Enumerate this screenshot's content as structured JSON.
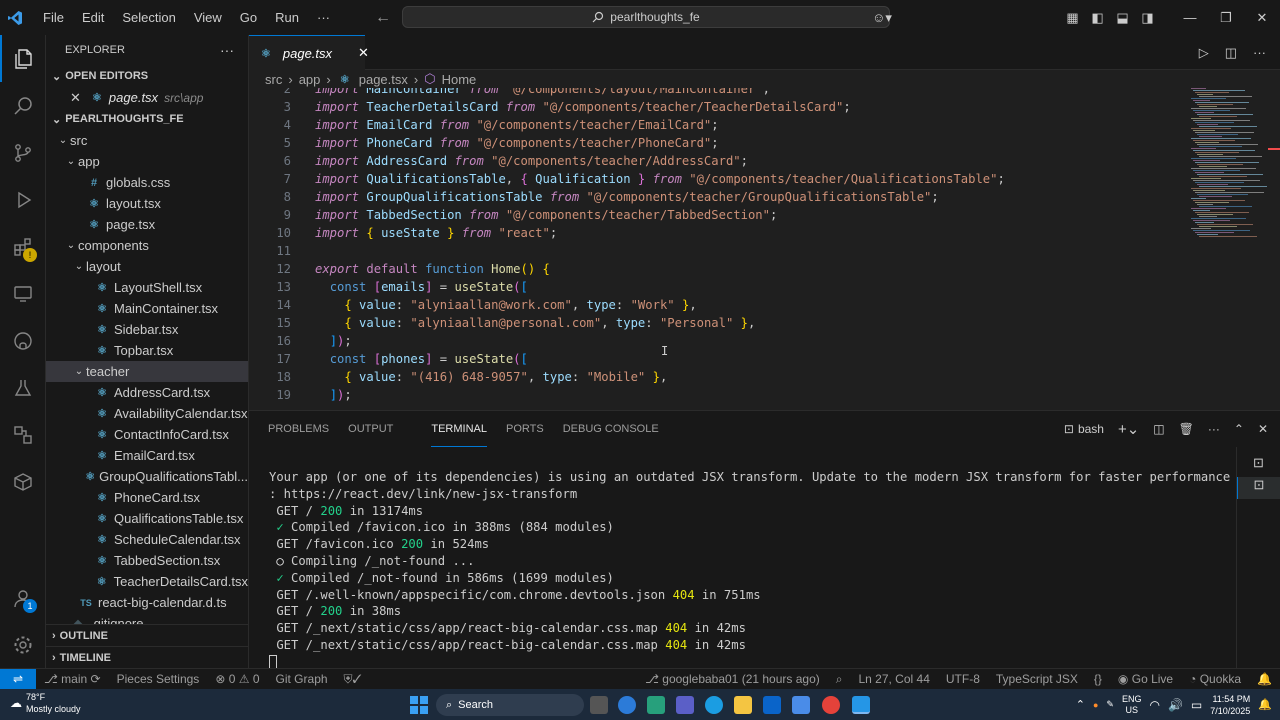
{
  "titlebar": {
    "menu": [
      "File",
      "Edit",
      "Selection",
      "View",
      "Go",
      "Run",
      "···"
    ],
    "search_label": "pearlthoughts_fe"
  },
  "sidebar": {
    "header": "EXPLORER",
    "open_editors_label": "OPEN EDITORS",
    "open_editor_file": "page.tsx",
    "open_editor_path": "src\\app",
    "project_label": "PEARLTHOUGHTS_FE",
    "tree": [
      {
        "label": "src",
        "depth": 1,
        "type": "folder-open"
      },
      {
        "label": "app",
        "depth": 2,
        "type": "folder-open"
      },
      {
        "label": "globals.css",
        "depth": 3,
        "type": "css",
        "icon": "#"
      },
      {
        "label": "layout.tsx",
        "depth": 3,
        "type": "tsx"
      },
      {
        "label": "page.tsx",
        "depth": 3,
        "type": "tsx"
      },
      {
        "label": "components",
        "depth": 2,
        "type": "folder-open"
      },
      {
        "label": "layout",
        "depth": 3,
        "type": "folder-open"
      },
      {
        "label": "LayoutShell.tsx",
        "depth": 4,
        "type": "tsx"
      },
      {
        "label": "MainContainer.tsx",
        "depth": 4,
        "type": "tsx"
      },
      {
        "label": "Sidebar.tsx",
        "depth": 4,
        "type": "tsx"
      },
      {
        "label": "Topbar.tsx",
        "depth": 4,
        "type": "tsx"
      },
      {
        "label": "teacher",
        "depth": 3,
        "type": "folder-open",
        "selected": true
      },
      {
        "label": "AddressCard.tsx",
        "depth": 4,
        "type": "tsx"
      },
      {
        "label": "AvailabilityCalendar.tsx",
        "depth": 4,
        "type": "tsx"
      },
      {
        "label": "ContactInfoCard.tsx",
        "depth": 4,
        "type": "tsx"
      },
      {
        "label": "EmailCard.tsx",
        "depth": 4,
        "type": "tsx"
      },
      {
        "label": "GroupQualificationsTabl...",
        "depth": 4,
        "type": "tsx"
      },
      {
        "label": "PhoneCard.tsx",
        "depth": 4,
        "type": "tsx"
      },
      {
        "label": "QualificationsTable.tsx",
        "depth": 4,
        "type": "tsx"
      },
      {
        "label": "ScheduleCalendar.tsx",
        "depth": 4,
        "type": "tsx"
      },
      {
        "label": "TabbedSection.tsx",
        "depth": 4,
        "type": "tsx"
      },
      {
        "label": "TeacherDetailsCard.tsx",
        "depth": 4,
        "type": "tsx"
      },
      {
        "label": "react-big-calendar.d.ts",
        "depth": 2,
        "type": "ts",
        "icon": "TS"
      },
      {
        "label": ".gitignore",
        "depth": 1,
        "type": "file"
      }
    ],
    "outline_label": "OUTLINE",
    "timeline_label": "TIMELINE"
  },
  "editor": {
    "tab_label": "page.tsx",
    "breadcrumbs": [
      "src",
      "app",
      "page.tsx",
      "Home"
    ],
    "line_numbers": [
      "2",
      "3",
      "4",
      "5",
      "6",
      "7",
      "8",
      "9",
      "10",
      "11",
      "12",
      "13",
      "14",
      "15",
      "16",
      "17",
      "18",
      "19"
    ]
  },
  "panel": {
    "tabs": [
      "PROBLEMS",
      "OUTPUT",
      "TERMINAL",
      "PORTS",
      "DEBUG CONSOLE"
    ],
    "active_tab": "TERMINAL",
    "shell_label": "bash"
  },
  "status": {
    "branch": "main",
    "pieces": "Pieces Settings",
    "errors": "0",
    "warnings": "0",
    "git_graph": "Git Graph",
    "blame": "googlebaba01 (21 hours ago)",
    "position": "Ln 27, Col 44",
    "encoding": "UTF-8",
    "language": "TypeScript JSX",
    "golive": "Go Live",
    "quokka": "Quokka"
  },
  "taskbar": {
    "weather_temp": "78°F",
    "weather_desc": "Mostly cloudy",
    "search_label": "Search",
    "lang": "ENG",
    "region": "US",
    "time": "11:54 PM",
    "date": "7/10/2025"
  },
  "colors": {
    "accent": "#0078d4",
    "keyword": "#c586c0",
    "string": "#ce9178",
    "function": "#dcdcaa",
    "variable": "#9cdcfe"
  }
}
